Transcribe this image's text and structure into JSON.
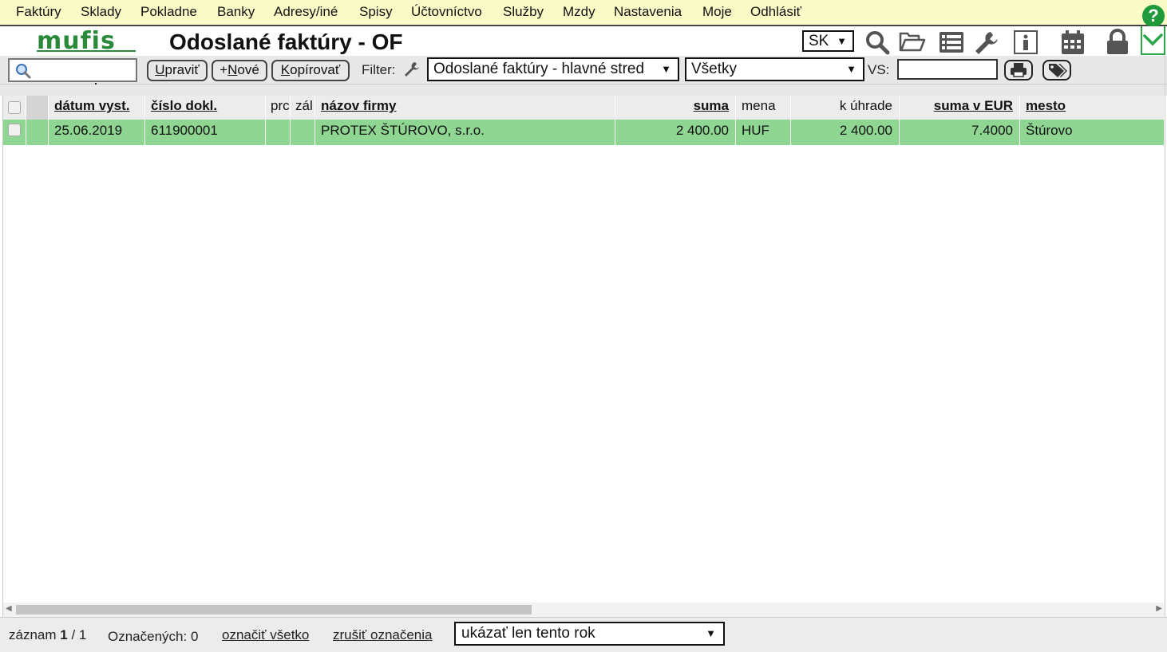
{
  "menu": {
    "items": [
      "Faktúry",
      "Sklady",
      "Pokladne",
      "Banky",
      "Adresy/iné",
      "Spisy",
      "Účtovníctvo",
      "Služby",
      "Mzdy",
      "Nastavenia",
      "Moje",
      "Odhlásiť"
    ],
    "help_icon": "question-circle-icon"
  },
  "logo_text": "mufis",
  "page_title": "Odoslané faktúry - OF",
  "language": {
    "selected": "SK"
  },
  "toolbar_icons": [
    "search-icon",
    "folder-open-icon",
    "list-icon",
    "wrench-icon",
    "info-icon",
    "calendar-icon",
    "lock-icon"
  ],
  "toolbar": {
    "search_value": "",
    "edit_first": "U",
    "edit_rest": "praviť",
    "new_prefix": "+",
    "new_first": "N",
    "new_rest": "ové",
    "copy_first": "K",
    "copy_rest": "opírovať",
    "filter_label": "Filter:",
    "filter_selected": "Odoslané faktúry - hlavné stred",
    "status_selected": "Všetky",
    "vs_label": "VS:",
    "vs_value": ""
  },
  "table": {
    "columns": [
      "dátum vyst.",
      "číslo dokl.",
      "prc",
      "zál",
      "názov firmy",
      "suma",
      "mena",
      "k úhrade",
      "suma v EUR",
      "mesto"
    ],
    "rows": [
      {
        "date": "25.06.2019",
        "doc_no": "611900001",
        "prc": "",
        "zal": "",
        "company": "PROTEX ŠTÚROVO, s.r.o.",
        "amount": "2 400.00",
        "currency": "HUF",
        "to_pay": "2 400.00",
        "amount_eur": "7.4000",
        "city": "Štúrovo",
        "row_color": "#8fd693"
      }
    ]
  },
  "footer": {
    "record_label": "záznam",
    "record_current": "1",
    "record_sep": "/ 1",
    "marked_label": "Označených: 0",
    "select_all": "označiť všetko",
    "clear_selection": "zrušiť označenia",
    "year_filter": "ukázať len tento rok"
  },
  "colors": {
    "menu_bg": "#fbfbc8",
    "accent_green": "#1e9a3a",
    "row_green": "#8fd693"
  }
}
